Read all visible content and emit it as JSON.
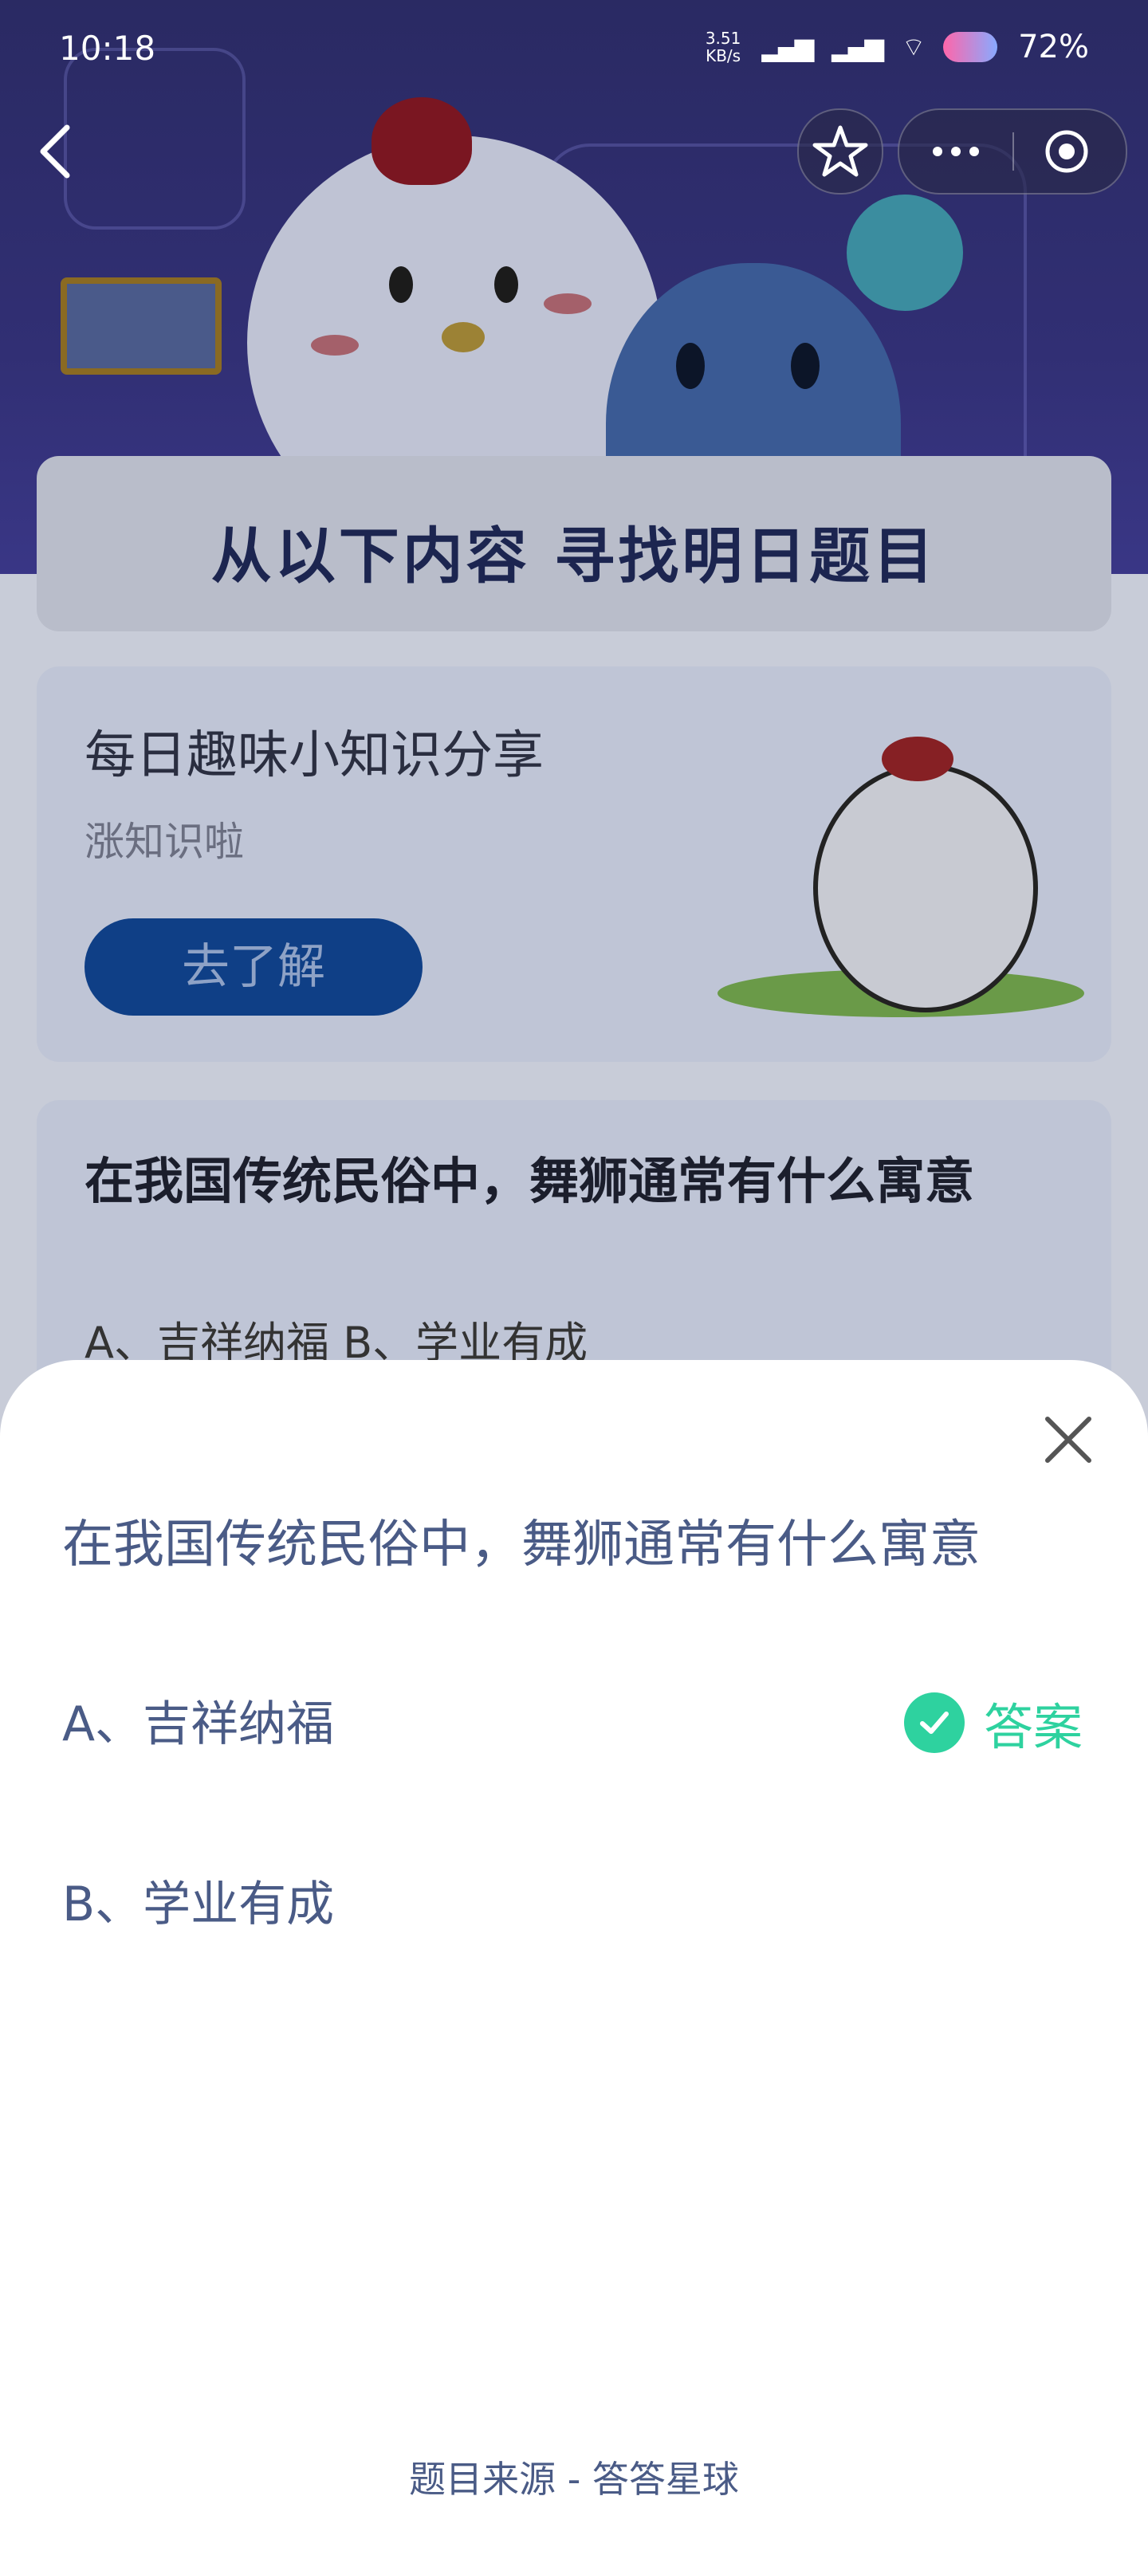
{
  "status": {
    "time": "10:18",
    "net_speed": "3.51",
    "net_unit": "KB/s",
    "signal": "·ıl",
    "battery": "72%"
  },
  "nav": {
    "back_icon": "chevron-left-icon",
    "star_icon": "star-icon",
    "more_icon": "more-dots-icon",
    "close_icon": "target-circle-icon"
  },
  "banner": {
    "title": "从以下内容  寻找明日题目"
  },
  "knowledge_card": {
    "title": "每日趣味小知识分享",
    "subtitle": "涨知识啦",
    "button": "去了解"
  },
  "question_card": {
    "title": "在我国传统民俗中，舞狮通常有什么寓意",
    "options": "A、吉祥纳福    B、学业有成"
  },
  "sheet": {
    "question": "在我国传统民俗中，舞狮通常有什么寓意",
    "options": [
      {
        "label": "A、吉祥纳福",
        "correct": true
      },
      {
        "label": "B、学业有成",
        "correct": false
      }
    ],
    "answer_label": "答案",
    "answer_color": "#2ed29f",
    "footer": "题目来源 - 答答星球"
  }
}
